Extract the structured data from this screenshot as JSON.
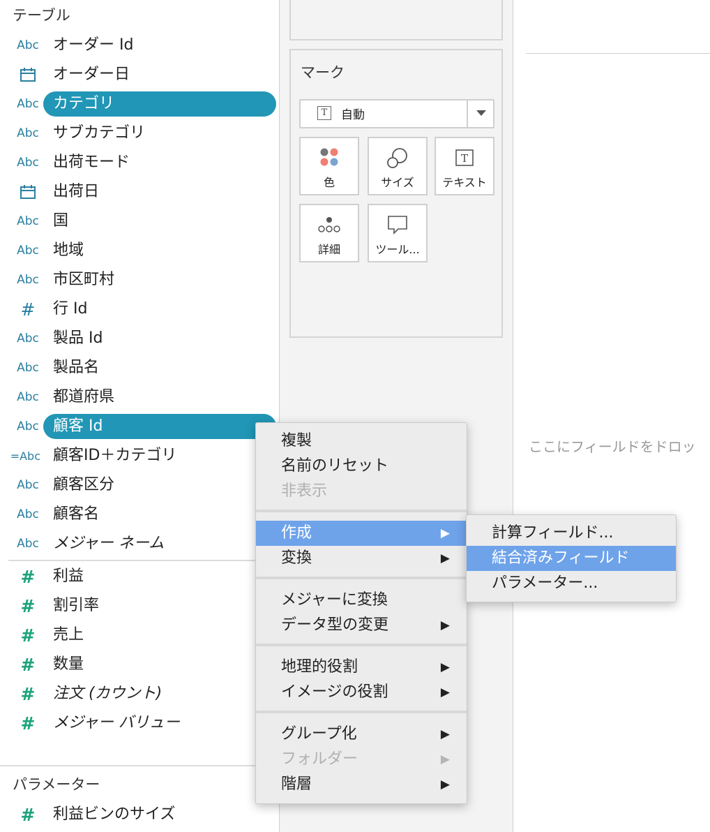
{
  "data_pane": {
    "tables_title": "テーブル",
    "dimensions": [
      {
        "icon": "Abc",
        "label": "オーダー Id"
      },
      {
        "icon": "calendar",
        "label": "オーダー日"
      },
      {
        "icon": "Abc",
        "label": "カテゴリ"
      },
      {
        "icon": "Abc",
        "label": "サブカテゴリ"
      },
      {
        "icon": "Abc",
        "label": "出荷モード"
      },
      {
        "icon": "calendar",
        "label": "出荷日"
      },
      {
        "icon": "Abc",
        "label": "国"
      },
      {
        "icon": "Abc",
        "label": "地域"
      },
      {
        "icon": "Abc",
        "label": "市区町村"
      },
      {
        "icon": "#",
        "label": "行 Id"
      },
      {
        "icon": "Abc",
        "label": "製品 Id"
      },
      {
        "icon": "Abc",
        "label": "製品名"
      },
      {
        "icon": "Abc",
        "label": "都道府県"
      },
      {
        "icon": "Abc",
        "label": "顧客 Id"
      },
      {
        "icon": "=Abc",
        "label": "顧客ID＋カテゴリ"
      },
      {
        "icon": "Abc",
        "label": "顧客区分"
      },
      {
        "icon": "Abc",
        "label": "顧客名"
      },
      {
        "icon": "Abc",
        "label": "メジャー ネーム"
      }
    ],
    "measures": [
      {
        "icon": "#",
        "label": "利益"
      },
      {
        "icon": "#",
        "label": "割引率"
      },
      {
        "icon": "#",
        "label": "売上"
      },
      {
        "icon": "#",
        "label": "数量"
      },
      {
        "icon": "#",
        "label": "注文 (カウント)"
      },
      {
        "icon": "#",
        "label": "メジャー バリュー"
      }
    ],
    "parameters_title": "パラメーター",
    "parameters": [
      {
        "icon": "#",
        "label": "利益ビンのサイズ"
      }
    ]
  },
  "marks": {
    "title": "マーク",
    "mark_type": "自動",
    "buttons": {
      "color": "色",
      "size": "サイズ",
      "text": "テキスト",
      "detail": "詳細",
      "tooltip": "ツール..."
    }
  },
  "canvas": {
    "drop_hint": "ここにフィールドをドロッ"
  },
  "context_menu": {
    "duplicate": "複製",
    "reset_name": "名前のリセット",
    "hide": "非表示",
    "create": "作成",
    "transform": "変換",
    "convert_to_measure": "メジャーに変換",
    "change_data_type": "データ型の変更",
    "geographic_role": "地理的役割",
    "image_role": "イメージの役割",
    "group": "グループ化",
    "folder": "フォルダー",
    "hierarchy": "階層"
  },
  "submenu": {
    "calculated_field": "計算フィールド...",
    "combined_field": "結合済みフィールド",
    "parameter": "パラメーター..."
  },
  "arrow_glyph": "▶",
  "colors": {
    "selection": "#2196b6",
    "menu_highlight": "#6ea3ea",
    "dimension_icon": "#2a7fa0",
    "measure_icon": "#1aa37a"
  }
}
